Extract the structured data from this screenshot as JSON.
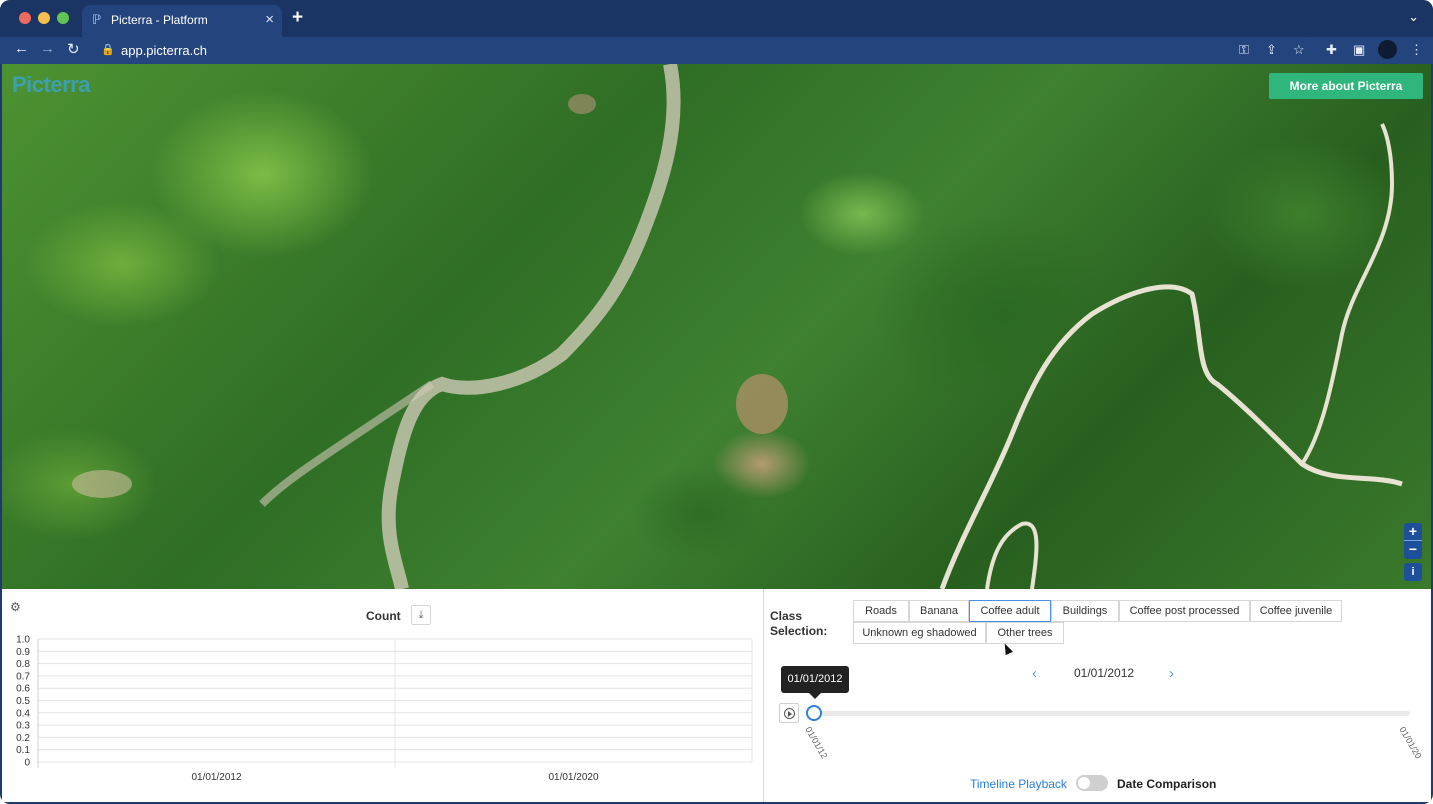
{
  "browser": {
    "tab_title": "Picterra - Platform",
    "url": "app.picterra.ch"
  },
  "map": {
    "logo_text": "Picterra",
    "more_button_label": "More about Picterra",
    "zoom_in_label": "+",
    "zoom_out_label": "−",
    "info_label": "i"
  },
  "chart": {
    "title": "Count",
    "download_icon": "download-icon",
    "settings_icon": "settings-icon"
  },
  "chart_data": {
    "type": "bar",
    "title": "Count",
    "categories": [
      "01/01/2012",
      "01/01/2020"
    ],
    "series": [],
    "yticks": [
      "1.0",
      "0.9",
      "0.8",
      "0.7",
      "0.6",
      "0.5",
      "0.4",
      "0.3",
      "0.2",
      "0.1",
      "0"
    ],
    "ylim": [
      0,
      1.0
    ],
    "grid": true
  },
  "class_selection": {
    "label": "Class Selection:",
    "chips": [
      {
        "label": "Roads",
        "active": false
      },
      {
        "label": "Banana",
        "active": false
      },
      {
        "label": "Coffee adult",
        "active": true
      },
      {
        "label": "Buildings",
        "active": false
      },
      {
        "label": "Coffee post processed",
        "active": false
      },
      {
        "label": "Coffee juvenile",
        "active": false
      },
      {
        "label": "Unknown eg shadowed",
        "active": false
      },
      {
        "label": "Other trees",
        "active": false
      }
    ]
  },
  "timeline": {
    "current_date": "01/01/2012",
    "tooltip_date": "01/01/2012",
    "tick_start": "01/01/12",
    "tick_end": "01/01/20",
    "prev_icon": "chevron-left-icon",
    "next_icon": "chevron-right-icon",
    "play_icon": "play-icon"
  },
  "mode_toggle": {
    "left_label": "Timeline Playback",
    "right_label": "Date Comparison",
    "on": false
  },
  "colors": {
    "accent_green": "#2fb67d",
    "accent_blue": "#2f7fd6",
    "browser_frame": "#1a3563"
  }
}
